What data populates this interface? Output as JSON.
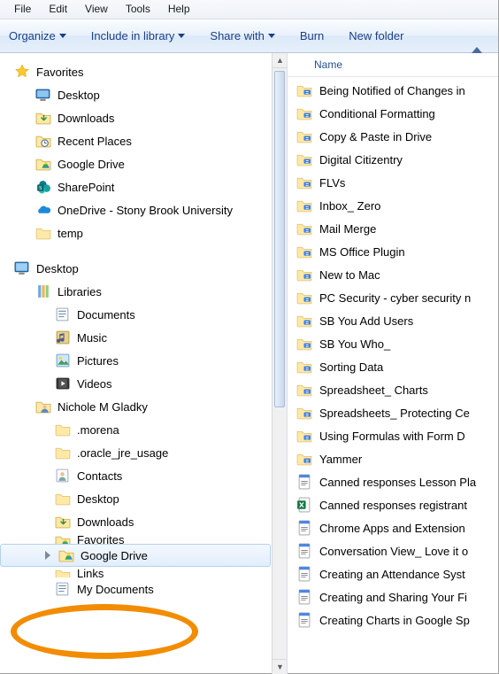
{
  "menu": [
    "File",
    "Edit",
    "View",
    "Tools",
    "Help"
  ],
  "toolbar": {
    "organize": "Organize",
    "include": "Include in library",
    "share": "Share with",
    "burn": "Burn",
    "newfolder": "New folder"
  },
  "column_header": "Name",
  "tree": {
    "favorites": {
      "label": "Favorites",
      "items": [
        {
          "label": "Desktop",
          "icon": "desktop"
        },
        {
          "label": "Downloads",
          "icon": "downloads"
        },
        {
          "label": "Recent Places",
          "icon": "recent"
        },
        {
          "label": "Google Drive",
          "icon": "gdrive"
        },
        {
          "label": "SharePoint",
          "icon": "sharepoint"
        },
        {
          "label": "OneDrive - Stony Brook University",
          "icon": "onedrive"
        },
        {
          "label": "temp",
          "icon": "folder"
        }
      ]
    },
    "desktop": {
      "label": "Desktop",
      "libraries": {
        "label": "Libraries",
        "items": [
          {
            "label": "Documents",
            "icon": "lib-doc"
          },
          {
            "label": "Music",
            "icon": "lib-music"
          },
          {
            "label": "Pictures",
            "icon": "lib-pic"
          },
          {
            "label": "Videos",
            "icon": "lib-vid"
          }
        ]
      },
      "user": {
        "label": "Nichole M Gladky",
        "items": [
          {
            "label": ".morena",
            "icon": "folder"
          },
          {
            "label": ".oracle_jre_usage",
            "icon": "folder"
          },
          {
            "label": "Contacts",
            "icon": "contacts"
          },
          {
            "label": "Desktop",
            "icon": "folder"
          },
          {
            "label": "Downloads",
            "icon": "downloads"
          },
          {
            "label": "Favorites",
            "icon": "gdrive",
            "truncated": true
          },
          {
            "label": "Google Drive",
            "icon": "gdrive",
            "selected": true
          },
          {
            "label": "Links",
            "icon": "folder",
            "truncated": true
          },
          {
            "label": "My Documents",
            "icon": "lib-doc"
          }
        ]
      }
    }
  },
  "files": [
    {
      "label": "Being Notified of Changes in",
      "icon": "gfolder"
    },
    {
      "label": "Conditional Formatting",
      "icon": "gfolder"
    },
    {
      "label": "Copy & Paste in Drive",
      "icon": "gfolder"
    },
    {
      "label": "Digital Citizentry",
      "icon": "gfolder"
    },
    {
      "label": "FLVs",
      "icon": "gfolder"
    },
    {
      "label": "Inbox_ Zero",
      "icon": "gfolder"
    },
    {
      "label": "Mail Merge",
      "icon": "gfolder"
    },
    {
      "label": "MS Office Plugin",
      "icon": "gfolder"
    },
    {
      "label": "New to Mac",
      "icon": "gfolder"
    },
    {
      "label": "PC Security - cyber security n",
      "icon": "gfolder"
    },
    {
      "label": "SB You Add Users",
      "icon": "gfolder"
    },
    {
      "label": "SB You Who_",
      "icon": "gfolder"
    },
    {
      "label": "Sorting Data",
      "icon": "gfolder"
    },
    {
      "label": "Spreadsheet_ Charts",
      "icon": "gfolder"
    },
    {
      "label": "Spreadsheets_ Protecting Ce",
      "icon": "gfolder"
    },
    {
      "label": "Using Formulas with Form D",
      "icon": "gfolder"
    },
    {
      "label": "Yammer",
      "icon": "gfolder"
    },
    {
      "label": "Canned responses Lesson Pla",
      "icon": "gdoc"
    },
    {
      "label": "Canned responses registrant",
      "icon": "excel"
    },
    {
      "label": "Chrome Apps and Extension",
      "icon": "gdoc"
    },
    {
      "label": "Conversation View_ Love it o",
      "icon": "gdoc"
    },
    {
      "label": "Creating an Attendance Syst",
      "icon": "gdoc"
    },
    {
      "label": "Creating and Sharing Your Fi",
      "icon": "gdoc"
    },
    {
      "label": "Creating Charts in Google Sp",
      "icon": "gdoc"
    }
  ]
}
